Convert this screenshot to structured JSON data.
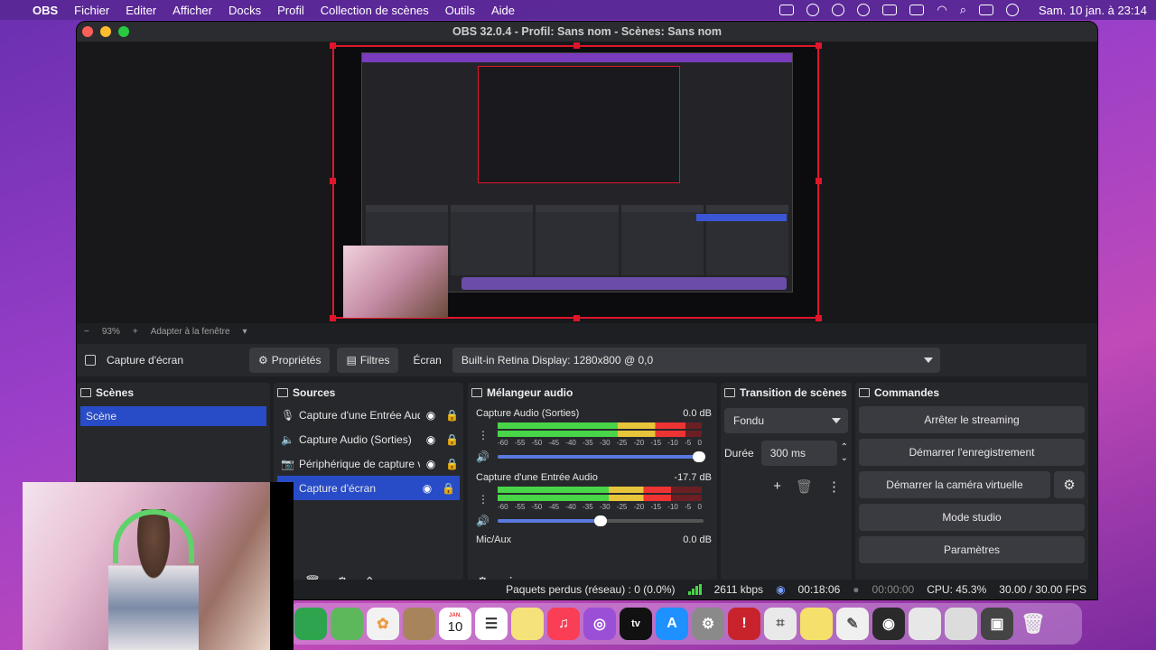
{
  "menubar": {
    "app": "OBS",
    "items": [
      "Fichier",
      "Editer",
      "Afficher",
      "Docks",
      "Profil",
      "Collection de scènes",
      "Outils",
      "Aide"
    ],
    "clock": "Sam. 10 jan. à 23:14"
  },
  "window": {
    "title": "OBS 32.0.4 - Profil: Sans nom - Scènes: Sans nom"
  },
  "preview_bar": {
    "minus": "−",
    "zoom": "93%",
    "plus": "+",
    "fit": "Adapter à la fenêtre"
  },
  "props_bar": {
    "source": "Capture d'écran",
    "properties": "Propriétés",
    "filters": "Filtres",
    "screen_label": "Écran",
    "screen_value": "Built-in Retina Display: 1280x800 @ 0,0"
  },
  "scenes": {
    "title": "Scènes",
    "items": [
      {
        "label": "Scène"
      }
    ]
  },
  "sources": {
    "title": "Sources",
    "items": [
      {
        "label": "Capture d'une Entrée Audi",
        "icon": "mic-icon"
      },
      {
        "label": "Capture Audio (Sorties)",
        "icon": "speaker-icon"
      },
      {
        "label": "Périphérique de capture v",
        "icon": "camera-icon"
      },
      {
        "label": "Capture d'écran",
        "icon": "monitor-icon"
      }
    ]
  },
  "mixer": {
    "title": "Mélangeur audio",
    "ticks": [
      "-60",
      "-55",
      "-50",
      "-45",
      "-40",
      "-35",
      "-30",
      "-25",
      "-20",
      "-15",
      "-10",
      "-5",
      "0"
    ],
    "channels": [
      {
        "name": "Capture Audio (Sorties)",
        "db": "0.0 dB",
        "level": 0.92,
        "volume": 1.0
      },
      {
        "name": "Capture d'une Entrée Audio",
        "db": "-17.7 dB",
        "level": 0.85,
        "volume": 0.52
      },
      {
        "name": "Mic/Aux",
        "db": "0.0 dB"
      }
    ]
  },
  "transition": {
    "title": "Transition de scènes",
    "type": "Fondu",
    "duration_label": "Durée",
    "duration_value": "300 ms"
  },
  "controls": {
    "title": "Commandes",
    "stop_stream": "Arrêter le streaming",
    "start_record": "Démarrer l'enregistrement",
    "virtual_cam": "Démarrer la caméra virtuelle",
    "studio_mode": "Mode studio",
    "settings": "Paramètres"
  },
  "status": {
    "dropped": "Paquets perdus (réseau) : 0 (0.0%)",
    "bitrate": "2611 kbps",
    "stream_time": "00:18:06",
    "rec_time": "00:00:00",
    "cpu": "CPU: 45.3%",
    "fps": "30.00 / 30.00 FPS"
  },
  "macdock": {
    "calendar_month": "JAN.",
    "calendar_day": "10"
  },
  "colors": {
    "accent": "#284cc7",
    "selection": "#e0152b",
    "meter_green": "#48d548"
  }
}
